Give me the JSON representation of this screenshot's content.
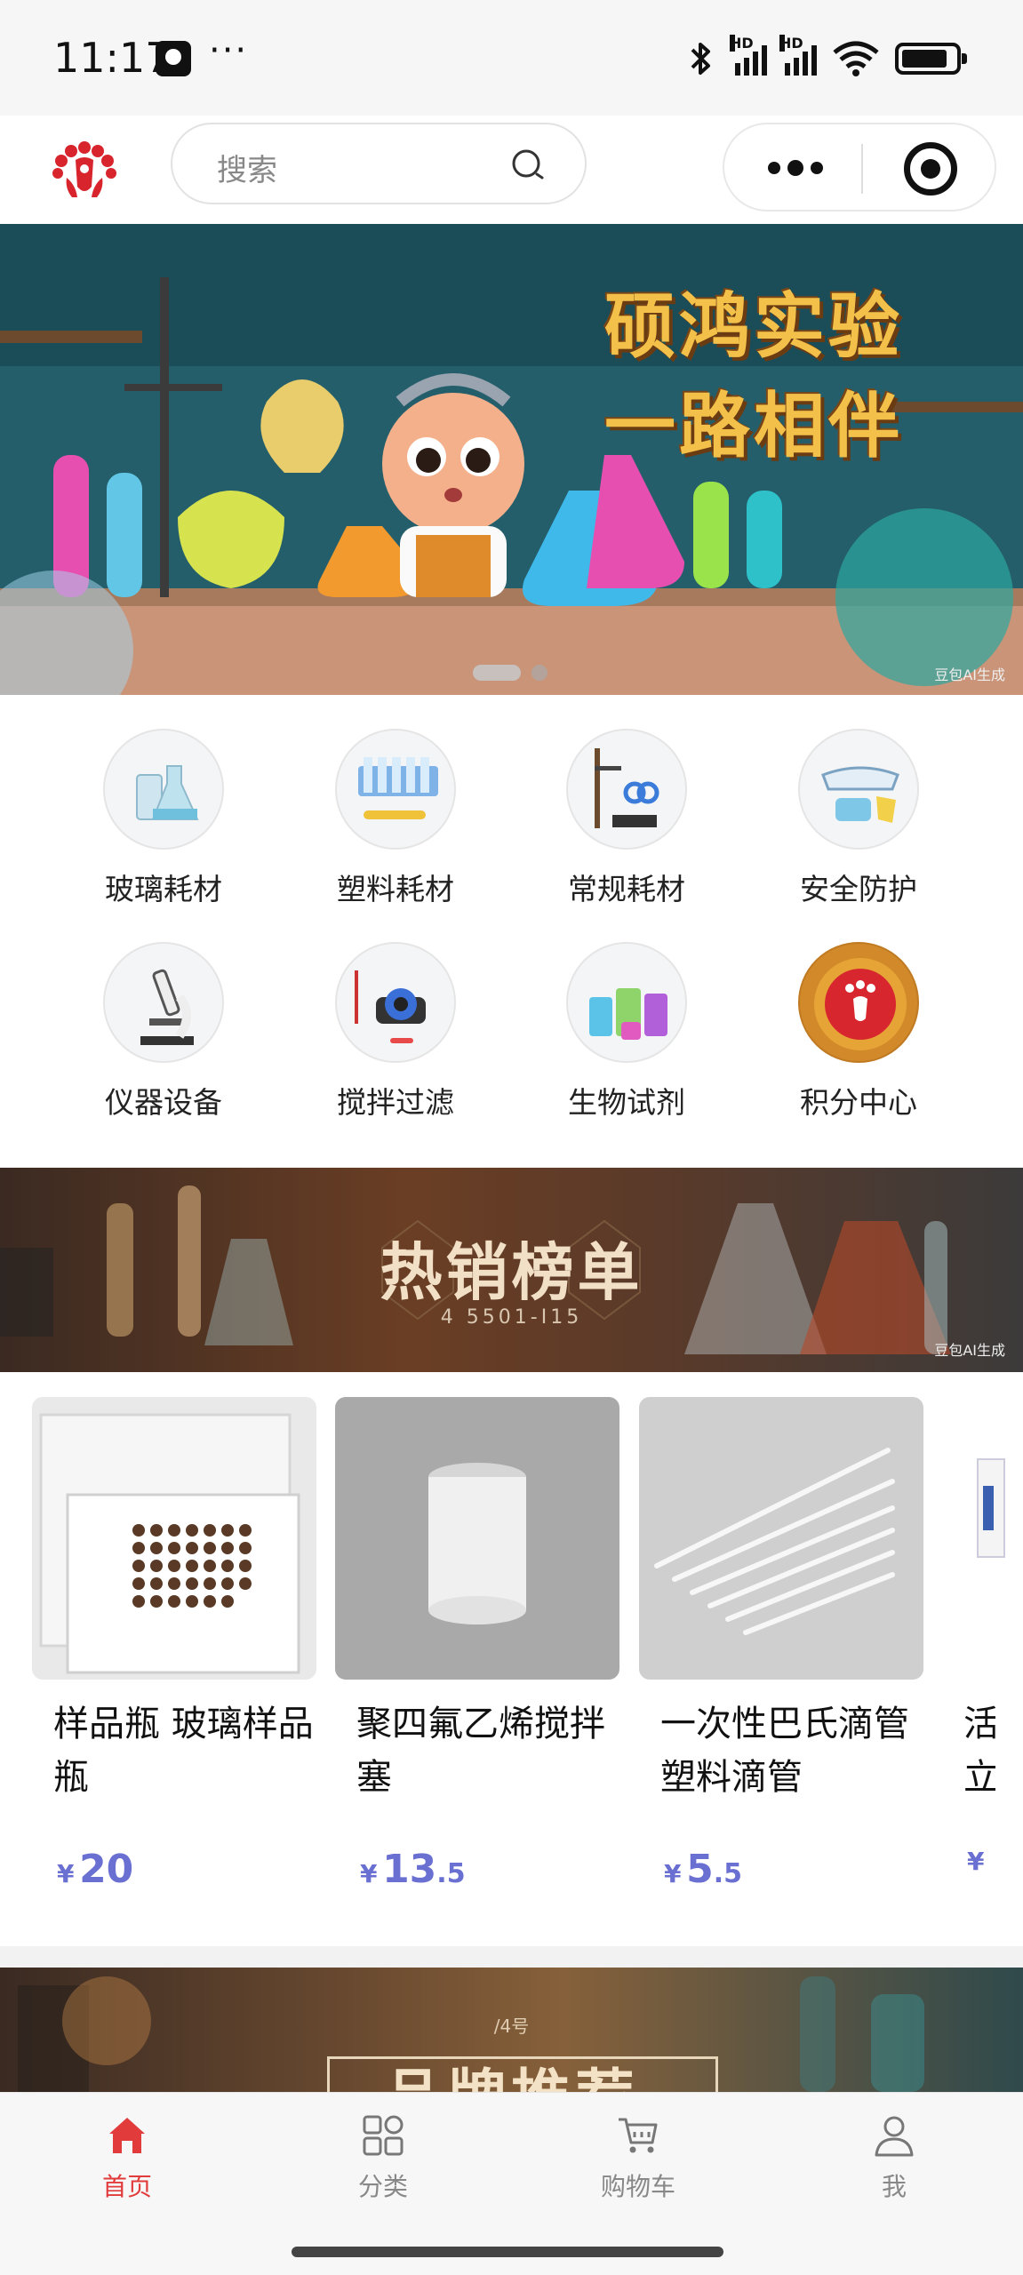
{
  "status_bar": {
    "time": "11:17",
    "dots": "···",
    "hd_1": "HD",
    "hd_2": "HD"
  },
  "search": {
    "placeholder": "搜索"
  },
  "hero": {
    "title_line1": "硕鸿实验",
    "title_line2": "一路相伴",
    "watermark": "豆包AI生成"
  },
  "categories": [
    {
      "label": "玻璃耗材",
      "icon": "glassware-icon"
    },
    {
      "label": "塑料耗材",
      "icon": "plastic-tubes-icon"
    },
    {
      "label": "常规耗材",
      "icon": "general-tools-icon"
    },
    {
      "label": "安全防护",
      "icon": "safety-gear-icon"
    },
    {
      "label": "仪器设备",
      "icon": "microscope-icon"
    },
    {
      "label": "搅拌过滤",
      "icon": "stirrer-icon"
    },
    {
      "label": "生物试剂",
      "icon": "reagent-bottles-icon"
    },
    {
      "label": "积分中心",
      "icon": "points-logo-icon"
    }
  ],
  "hot_banner": {
    "title": "热销榜单",
    "subtitle": "4 5501-I15",
    "watermark": "豆包AI生成"
  },
  "products": [
    {
      "name": "样品瓶 玻璃样品瓶",
      "currency": "¥",
      "price_int": "20",
      "price_dec": ""
    },
    {
      "name": "聚四氟乙烯搅拌塞",
      "currency": "¥",
      "price_int": "13",
      "price_dec": ".5"
    },
    {
      "name": "一次性巴氏滴管 塑料滴管",
      "currency": "¥",
      "price_int": "5",
      "price_dec": ".5"
    },
    {
      "name": "活立",
      "currency": "¥",
      "price_int": "",
      "price_dec": ""
    }
  ],
  "brand_banner": {
    "title": "品牌推荐",
    "subtitle": "/4号"
  },
  "tabbar": {
    "items": [
      {
        "label": "首页",
        "active": true
      },
      {
        "label": "分类",
        "active": false
      },
      {
        "label": "购物车",
        "active": false
      },
      {
        "label": "我",
        "active": false
      }
    ]
  },
  "colors": {
    "accent": "#e23b3b",
    "price": "#6a6fd2",
    "hero_title": "#f3c14a"
  }
}
